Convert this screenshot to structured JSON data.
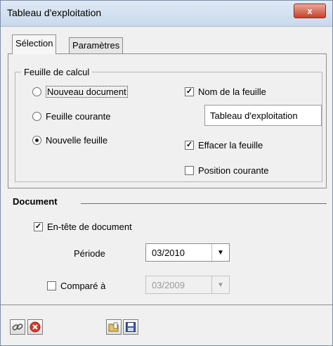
{
  "window": {
    "title": "Tableau d'exploitation",
    "close_label": "x"
  },
  "tabs": [
    {
      "label": "Sélection"
    },
    {
      "label": "Paramètres"
    }
  ],
  "calc_sheet": {
    "legend": "Feuille de calcul",
    "radios": [
      {
        "label": "Nouveau document",
        "checked": false
      },
      {
        "label": "Feuille courante",
        "checked": false
      },
      {
        "label": "Nouvelle feuille",
        "checked": true
      }
    ],
    "sheet_name": {
      "label": "Nom de la feuille",
      "checked": true,
      "value": "Tableau d'exploitation"
    },
    "clear_sheet": {
      "label": "Effacer la feuille",
      "checked": true
    },
    "current_position": {
      "label": "Position courante",
      "checked": false
    }
  },
  "document": {
    "title": "Document",
    "header": {
      "label": "En-tête de document",
      "checked": true
    },
    "period": {
      "label": "Période",
      "value": "03/2010"
    },
    "compare": {
      "label": "Comparé à",
      "checked": false,
      "value": "03/2009"
    }
  },
  "toolbar": [
    {
      "icon": "link-icon"
    },
    {
      "icon": "cancel-icon"
    },
    {
      "icon": "open-folder-icon"
    },
    {
      "icon": "save-icon"
    }
  ]
}
